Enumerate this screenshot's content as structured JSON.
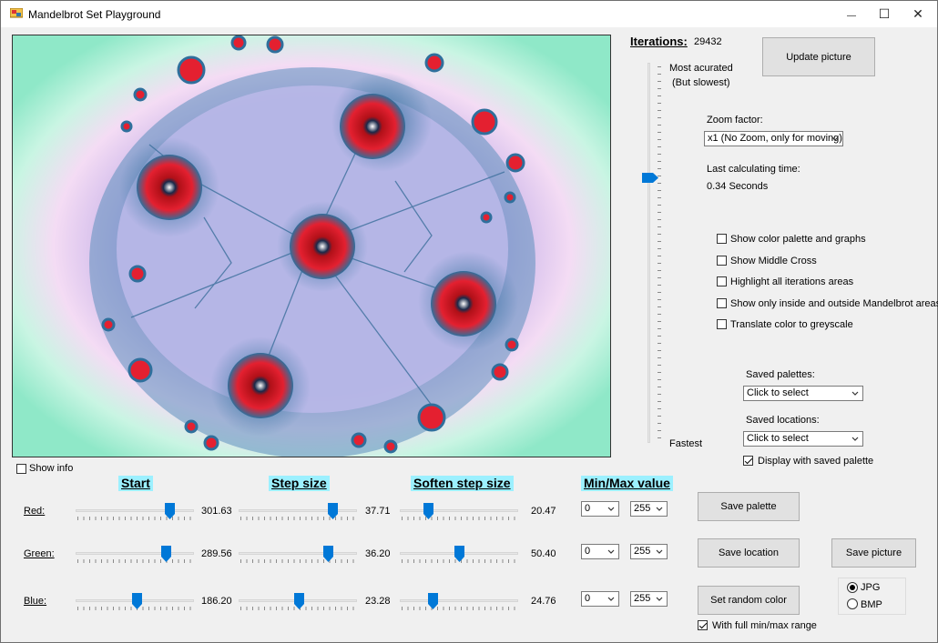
{
  "window": {
    "title": "Mandelbrot Set Playground",
    "minimize": "—",
    "maximize": "☐",
    "close": "✕"
  },
  "iterations": {
    "label": "Iterations:",
    "value": "29432",
    "slider_value": 29432,
    "top_label1": "Most acurated",
    "top_label2": "(But slowest)",
    "bottom_label": "Fastest"
  },
  "update_button": "Update picture",
  "zoom": {
    "label": "Zoom factor:",
    "selected": "x1 (No Zoom, only for moving)"
  },
  "calc": {
    "label": "Last calculating time:",
    "value": "0.34 Seconds"
  },
  "options": [
    {
      "label": "Show color palette and graphs",
      "checked": false
    },
    {
      "label": "Show Middle Cross",
      "checked": false
    },
    {
      "label": "Highlight all iterations areas",
      "checked": false
    },
    {
      "label": "Show only inside and outside Mandelbrot areas",
      "checked": false
    },
    {
      "label": "Translate color to greyscale",
      "checked": false
    }
  ],
  "saved_palettes": {
    "label": "Saved palettes:",
    "selected": "Click to select"
  },
  "saved_locations": {
    "label": "Saved locations:",
    "selected": "Click to select"
  },
  "display_saved_palette": {
    "label": "Display with saved palette",
    "checked": true
  },
  "show_info": {
    "label": "Show info",
    "checked": false
  },
  "headers": {
    "start": "Start",
    "step": "Step size",
    "soften": "Soften step size",
    "minmax": "Min/Max value"
  },
  "channels": [
    {
      "name": "Red:",
      "start": "301.63",
      "step": "37.71",
      "soften": "20.47",
      "min": "0",
      "max": "255",
      "start_pct": 0.82,
      "step_pct": 0.82,
      "soften_pct": 0.22
    },
    {
      "name": "Green:",
      "start": "289.56",
      "step": "36.20",
      "soften": "50.40",
      "min": "0",
      "max": "255",
      "start_pct": 0.79,
      "step_pct": 0.78,
      "soften_pct": 0.5
    },
    {
      "name": "Blue:",
      "start": "186.20",
      "step": "23.28",
      "soften": "24.76",
      "min": "0",
      "max": "255",
      "start_pct": 0.52,
      "step_pct": 0.51,
      "soften_pct": 0.26
    }
  ],
  "buttons": {
    "save_palette": "Save  palette",
    "save_location": "Save location",
    "save_picture": "Save picture",
    "random_color": "Set random color"
  },
  "full_range": {
    "label": "With full min/max range",
    "checked": true
  },
  "format": {
    "jpg": "JPG",
    "bmp": "BMP",
    "selected": "JPG"
  },
  "colors": {
    "accent": "#0078d7",
    "header_bg": "#9cf0ff",
    "fractal_red": "#e0202a",
    "fractal_blue": "#2f6f9c",
    "fractal_lavender": "#c8c4ee",
    "fractal_mint": "#8fe8c8"
  }
}
